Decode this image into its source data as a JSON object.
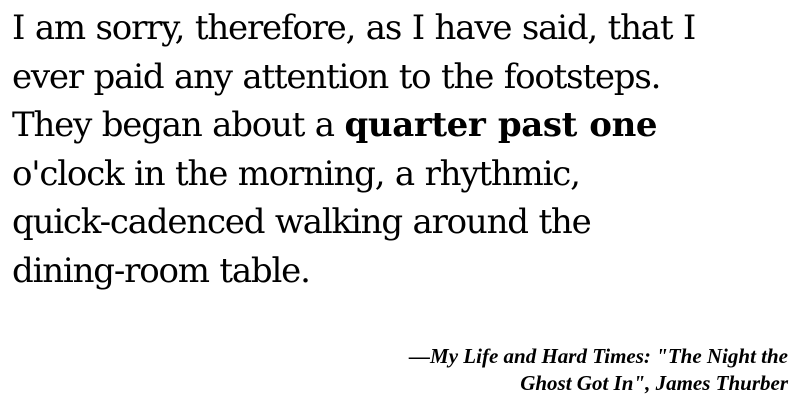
{
  "quote": {
    "line1": "I am sorry, therefore, as I have said, that I",
    "line2": "ever paid any attention to the footsteps.",
    "line3_before": "They began about a ",
    "line3_emphasis": "quarter past one",
    "line4": "o'clock in the morning, a rhythmic,",
    "line5": "quick-cadenced walking around the",
    "line6": "dining-room table."
  },
  "attribution": {
    "line1": "—My Life and Hard Times: \"The Night the",
    "line2": "Ghost Got In\", James Thurber"
  }
}
